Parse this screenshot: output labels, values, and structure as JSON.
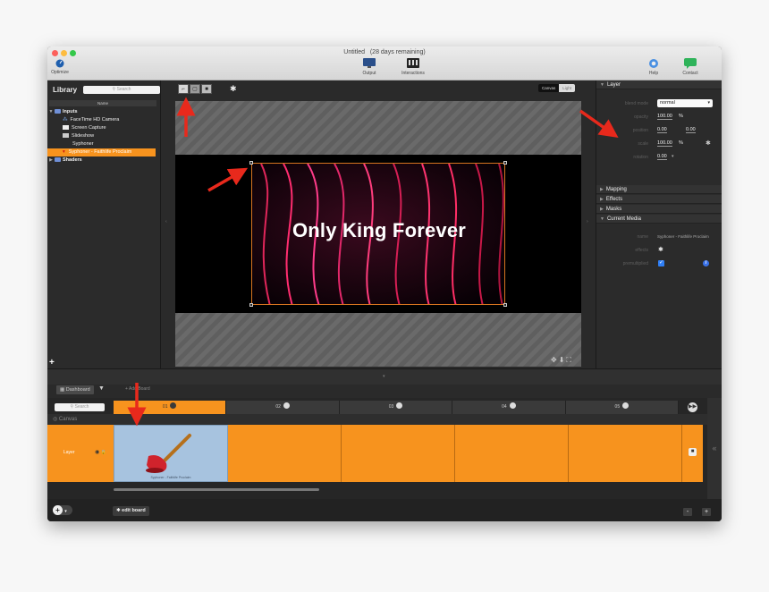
{
  "window": {
    "title": "Untitled",
    "trial_note": "(28 days remaining)"
  },
  "toolbar": {
    "optimize": "Optimize",
    "output": "Output",
    "interactions": "Interactions",
    "help": "Help",
    "contact": "Contact"
  },
  "library": {
    "title": "Library",
    "search_placeholder": "Search",
    "column_name": "Name",
    "items": [
      {
        "label": "Inputs",
        "kind": "folder"
      },
      {
        "label": "FaceTime HD Camera",
        "kind": "camera"
      },
      {
        "label": "Screen Capture",
        "kind": "screen"
      },
      {
        "label": "Slideshow",
        "kind": "slides"
      },
      {
        "label": "Syphoner",
        "kind": "plain"
      },
      {
        "label": "Syphoner - Faithlife Proclaim",
        "kind": "selected"
      },
      {
        "label": "Shaders",
        "kind": "folder"
      }
    ],
    "add": "+"
  },
  "canvas": {
    "toggle_canvas": "Canvas",
    "toggle_light": "Light",
    "media_text": "Only King Forever"
  },
  "inspector": {
    "layer_header": "Layer",
    "blend_mode_label": "blend mode",
    "blend_mode_value": "normal",
    "opacity_label": "opacity",
    "opacity_value": "100.00",
    "position_label": "position",
    "position_x": "0.00",
    "position_y": "0.00",
    "scale_label": "scale",
    "scale_value": "100.00",
    "rotation_label": "rotation",
    "rotation_value": "0.00",
    "percent": "%",
    "mapping": "Mapping",
    "effects": "Effects",
    "masks": "Masks",
    "current_media": "Current Media",
    "name_label": "name",
    "name_value": "Syphoner - Faithlife Proclaim",
    "effects_label": "effects",
    "premultiplied_label": "premultiplied",
    "info": "i"
  },
  "dashboard": {
    "tab": "Dashboard",
    "add_board": "+ Add Board"
  },
  "timeline": {
    "search_placeholder": "Search",
    "columns": [
      "01",
      "02",
      "03",
      "04",
      "05"
    ],
    "canvas_label": "Canvas",
    "layer_label": "Layer",
    "clip_caption": "Syphoner - Faithlife Proclaim"
  },
  "bottombar": {
    "edit_board": "edit board",
    "zoom_out": "-",
    "zoom_in": "+"
  },
  "colors": {
    "accent_orange": "#f7931e",
    "annotation_red": "#e8291c"
  }
}
